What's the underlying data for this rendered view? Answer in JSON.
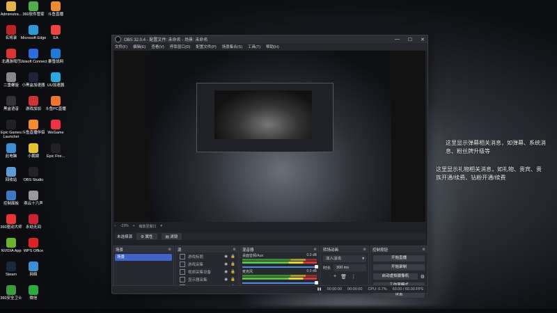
{
  "desktop": {
    "icons": [
      {
        "label": "Administra...",
        "color": "#e6b34a"
      },
      {
        "label": "360软件管家",
        "color": "#4fb04a"
      },
      {
        "label": "斗鱼直播",
        "color": "#f08a2a"
      },
      {
        "label": "名将录",
        "color": "#b22"
      },
      {
        "label": "Microsoft Edge",
        "color": "#2a9bd8"
      },
      {
        "label": "EA",
        "color": "#e44"
      },
      {
        "label": "北通游戏厅",
        "color": "#d33"
      },
      {
        "label": "Ubisoft Connect",
        "color": "#2a6fd8"
      },
      {
        "label": "暴雪战网",
        "color": "#1b7bd6"
      },
      {
        "label": "二重螺旋",
        "color": "#888"
      },
      {
        "label": "小黑盒加速器",
        "color": "#223"
      },
      {
        "label": "UU加速器",
        "color": "#2aa9e0"
      },
      {
        "label": "黑盒语音",
        "color": "#333"
      },
      {
        "label": "游戏加加",
        "color": "#c33"
      },
      {
        "label": "斗鱼PC直播",
        "color": "#f0752a"
      },
      {
        "label": "Epic Games Launcher",
        "color": "#222"
      },
      {
        "label": "斗鱼直播伴侣",
        "color": "#f38b2c"
      },
      {
        "label": "WeGame",
        "color": "#e34"
      },
      {
        "label": "此电脑",
        "color": "#3a8fd8"
      },
      {
        "label": "小鹅娱",
        "color": "#e8c22a"
      },
      {
        "label": "Epic Fire...",
        "color": "#222"
      },
      {
        "label": "回收站",
        "color": "#5a9bd8"
      },
      {
        "label": "OBS Studio",
        "color": "#222"
      },
      {
        "label": "控制面板",
        "color": "#3a78c8"
      },
      {
        "label": "燕云十六声",
        "color": "#999"
      },
      {
        "label": "360驱动大师",
        "color": "#e33"
      },
      {
        "label": "永劫无间",
        "color": "#c23"
      },
      {
        "label": "NVIDIA App",
        "color": "#6cb52a"
      },
      {
        "label": "WPS Office",
        "color": "#d22"
      },
      {
        "label": "Steam",
        "color": "#1b2838"
      },
      {
        "label": "网络",
        "color": "#3a8fd8"
      },
      {
        "label": "360安全卫士",
        "color": "#3b9c3b"
      },
      {
        "label": "微信",
        "color": "#2aae3a"
      }
    ]
  },
  "overlay": {
    "line1": "这里显示弹幕相关消息，如弹幕、系统消",
    "line2": "息、粉丝牌升级等",
    "line3": "这里显示礼物相关消息，如礼物、贵宾、贵",
    "line4": "族开通/续费、钻粉开通/续费"
  },
  "obs": {
    "title": "OBS 32.0.4 - 配置文件: 未命名 - 场景: 未命名",
    "menu": [
      "文件(F)",
      "编辑(E)",
      "查看(V)",
      "停靠窗口(D)",
      "配置文件(P)",
      "场景集合(S)",
      "工具(T)",
      "帮助(H)"
    ],
    "zoom": "-23%",
    "zoom_label": "缩放至窗口",
    "no_source": "未选择源",
    "properties_btn": "属性",
    "filters_btn": "滤镜",
    "scenes": {
      "title": "场景",
      "items": [
        "场景"
      ]
    },
    "sources": {
      "title": "源",
      "items": [
        "游戏标题",
        "游戏采集",
        "视频采集设备",
        "显示器采集",
        "音频输入采集"
      ]
    },
    "mixer": {
      "title": "混音器",
      "channels": [
        {
          "name": "桌面音频/Aux",
          "db": "0.0 dB"
        },
        {
          "name": "麦克风",
          "db": "0.0 dB"
        }
      ]
    },
    "transitions": {
      "title": "转场动画",
      "type": "淡入淡出",
      "duration_label": "时长",
      "duration": "300 ms"
    },
    "controls": {
      "title": "控制按钮",
      "buttons": [
        "开始直播",
        "开始录制",
        "启动虚拟摄像机",
        "工作室模式",
        "设置"
      ]
    },
    "status": {
      "t1": "00:00:00",
      "t2": "00:00:00",
      "cpu": "CPU: 0.7%",
      "fps": "60.00 / 60.00 FPS"
    }
  }
}
